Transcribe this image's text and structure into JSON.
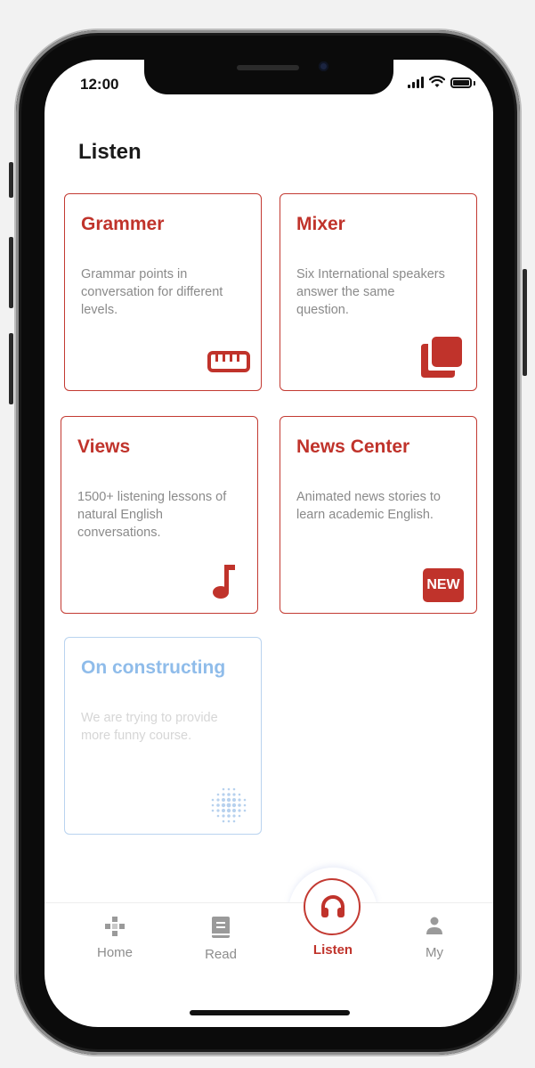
{
  "status_bar": {
    "time": "12:00"
  },
  "header": {
    "title": "Listen"
  },
  "cards": [
    {
      "title": "Grammer",
      "description": "Grammar points in conversation for different levels.",
      "icon": "ruler-icon"
    },
    {
      "title": "Mixer",
      "description": "Six International speakers answer the same question.",
      "icon": "copy-icon"
    },
    {
      "title": "Views",
      "description": "1500+ listening lessons of natural English conversations.",
      "icon": "music-note-icon"
    },
    {
      "title": "News Center",
      "description": "Animated news stories to learn academic English.",
      "icon": "new-badge-icon",
      "badge": "NEW"
    },
    {
      "title": "On constructing",
      "description": "We are trying to provide more funny course.",
      "icon": "dots-sphere-icon"
    }
  ],
  "tabbar": {
    "tabs": [
      {
        "label": "Home",
        "icon": "puzzle-icon",
        "active": false
      },
      {
        "label": "Read",
        "icon": "book-icon",
        "active": false
      },
      {
        "label": "Listen",
        "icon": "headphones-icon",
        "active": true
      },
      {
        "label": "My",
        "icon": "person-icon",
        "active": false
      }
    ]
  },
  "colors": {
    "accent": "#c0332b",
    "disabled_accent": "#8fbcea",
    "text_muted": "#8a8a8a"
  }
}
